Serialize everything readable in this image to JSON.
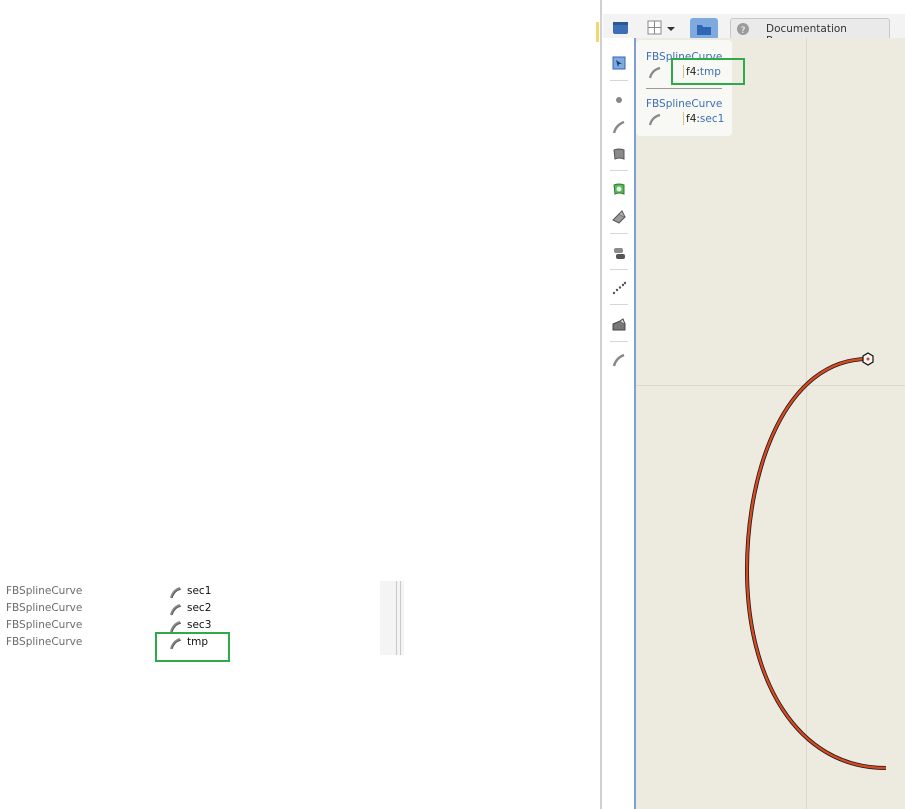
{
  "header": {
    "documentation_browser_label": "Documentation Browser",
    "help_icon": "question-circle-icon",
    "view_layout_icon": "layout-icon",
    "folder_icon": "folder-icon"
  },
  "toolbar": {
    "tools": [
      "select-icon",
      "point-icon",
      "curve-icon",
      "surface-icon",
      "nurbs-surface-icon",
      "plane-icon",
      "pipe-icon",
      "points-cloud-icon",
      "solid-icon",
      "spline-icon"
    ]
  },
  "object_list": {
    "rows": [
      {
        "type": "FBSplineCurve",
        "name": "sec1"
      },
      {
        "type": "FBSplineCurve",
        "name": "sec2"
      },
      {
        "type": "FBSplineCurve",
        "name": "sec3"
      },
      {
        "type": "FBSplineCurve",
        "name": "tmp"
      }
    ]
  },
  "popup": {
    "items": [
      {
        "type": "FBSplineCurve",
        "prefix": "f4:",
        "name": "tmp"
      },
      {
        "type": "FBSplineCurve",
        "prefix": "f4:",
        "name": "sec1"
      }
    ]
  },
  "colors": {
    "highlight": "#2faa4a",
    "curve": "#d9481f",
    "viewport_bg": "#edebe0",
    "accent": "#3d6fb6"
  }
}
